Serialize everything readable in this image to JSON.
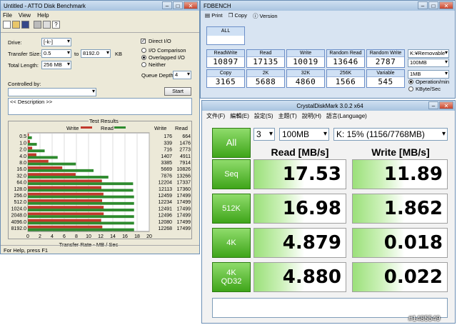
{
  "atto": {
    "title": "Untitled - ATTO Disk Benchmark",
    "menu": [
      "File",
      "View",
      "Help"
    ],
    "drive_label": "Drive:",
    "drive_value": "[-k-]",
    "direct_io": "Direct I/O",
    "transfer_size_label": "Transfer Size:",
    "transfer_from": "0.5",
    "transfer_to_label": "to",
    "transfer_to": "8192.0",
    "transfer_unit": "KB",
    "total_length_label": "Total Length:",
    "total_length": "256 MB",
    "io_comparison": "I/O Comparison",
    "overlapped_io": "Overlapped I/O",
    "neither": "Neither",
    "queue_depth_label": "Queue Depth:",
    "queue_depth": "4",
    "controlled_by": "Controlled by:",
    "start": "Start",
    "description": "<< Description >>",
    "test_results": "Test Results",
    "legend_write": "Write",
    "legend_read": "Read",
    "col_write": "Write",
    "col_read": "Read",
    "xlabel": "Transfer Rate - MB / Sec",
    "status": "For Help, press F1",
    "colors": {
      "write": "#c0392b",
      "read": "#2e8b2e"
    }
  },
  "chart_data": {
    "type": "bar",
    "orientation": "horizontal",
    "title": "Test Results",
    "categories": [
      "0.5",
      "1.0",
      "2.0",
      "4.0",
      "8.0",
      "16.0",
      "32.0",
      "64.0",
      "128.0",
      "256.0",
      "512.0",
      "1024.0",
      "2048.0",
      "4096.0",
      "8192.0"
    ],
    "series": [
      {
        "name": "Write",
        "values": [
          176,
          339,
          716,
          1407,
          3385,
          5669,
          7876,
          12204,
          12113,
          12459,
          12234,
          12491,
          12496,
          12080,
          12268
        ]
      },
      {
        "name": "Read",
        "values": [
          664,
          1476,
          2773,
          4911,
          7914,
          10826,
          13266,
          17337,
          17360,
          17499,
          17499,
          17499,
          17499,
          17499,
          17499
        ]
      }
    ],
    "xlabel": "Transfer Rate - MB / Sec",
    "xticks": [
      "0",
      "2",
      "4",
      "6",
      "8",
      "10",
      "12",
      "14",
      "16",
      "18",
      "20"
    ],
    "xlim": [
      0,
      20000
    ],
    "legend": "top-center"
  },
  "fdbench": {
    "title": "FDBENCH",
    "toolbar": [
      "Print",
      "Copy",
      "Version"
    ],
    "all": "ALL",
    "row1": [
      {
        "label": "ReadWrite",
        "value": "10897"
      },
      {
        "label": "Read",
        "value": "17135"
      },
      {
        "label": "Write",
        "value": "10019"
      },
      {
        "label": "Random Read",
        "value": "13646"
      },
      {
        "label": "Random Write",
        "value": "2787"
      }
    ],
    "row2": [
      {
        "label": "Copy",
        "value": "3165"
      },
      {
        "label": "2K",
        "value": "5688"
      },
      {
        "label": "32K",
        "value": "4860"
      },
      {
        "label": "256K",
        "value": "1566"
      },
      {
        "label": "Variable",
        "value": "545"
      }
    ],
    "drive": "K:¥Removable",
    "size1": "100MB",
    "size2": "1MB",
    "opt1": "Operation/min",
    "opt2": "KByte/Sec"
  },
  "cdm": {
    "title": "CrystalDiskMark 3.0.2 x64",
    "menu": [
      "文件(F)",
      "編輯(E)",
      "設定(S)",
      "主題(T)",
      "說明(H)",
      "語言(Language)"
    ],
    "all": "All",
    "count": "3",
    "size": "100MB",
    "drive": "K: 15% (1156/7768MB)",
    "head_read": "Read [MB/s]",
    "head_write": "Write [MB/s]",
    "rows": [
      {
        "label": "Seq",
        "read": "17.53",
        "write": "11.89"
      },
      {
        "label": "512K",
        "read": "16.98",
        "write": "1.862"
      },
      {
        "label": "4K",
        "read": "4.879",
        "write": "0.018"
      },
      {
        "label": "4K\nQD32",
        "read": "4.880",
        "write": "0.022"
      }
    ],
    "accent": "#3fa51a"
  },
  "watermark": "#1485549"
}
